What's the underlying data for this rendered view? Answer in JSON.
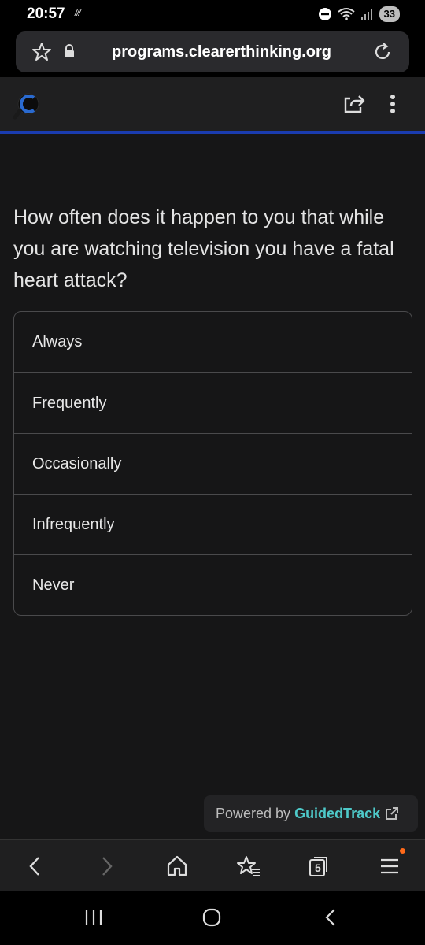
{
  "status_bar": {
    "time": "20:57",
    "misc": "///",
    "battery": "33"
  },
  "browser": {
    "url": "programs.clearerthinking.org",
    "tab_count": "5"
  },
  "survey": {
    "question": "How often does it happen to you that while you are watching television you have a fatal heart attack?",
    "options": [
      {
        "label": "Always"
      },
      {
        "label": "Frequently"
      },
      {
        "label": "Occasionally"
      },
      {
        "label": "Infrequently"
      },
      {
        "label": "Never"
      }
    ]
  },
  "footer": {
    "powered_by": "Powered by",
    "brand": "GuidedTrack"
  },
  "colors": {
    "accent_bar": "#1a3cb0",
    "brand": "#4ec9c9",
    "notification_dot": "#ff6a1a"
  }
}
